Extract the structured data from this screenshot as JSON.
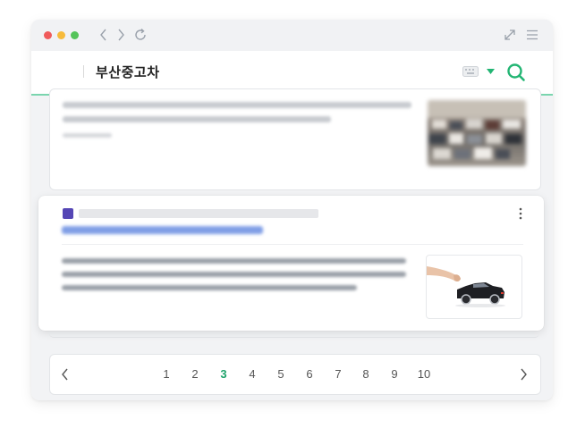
{
  "browser": {
    "nav_icons": [
      "back-icon",
      "forward-icon",
      "reload-icon"
    ],
    "right_icons": [
      "expand-icon",
      "menu-icon"
    ]
  },
  "search": {
    "query": "부산중고차",
    "icons": [
      "keyboard-icon",
      "dropdown-caret-icon",
      "search-icon"
    ],
    "accent_color": "#22b573"
  },
  "pagination": {
    "pages": [
      "1",
      "2",
      "3",
      "4",
      "5",
      "6",
      "7",
      "8",
      "9",
      "10"
    ],
    "current": "3"
  }
}
